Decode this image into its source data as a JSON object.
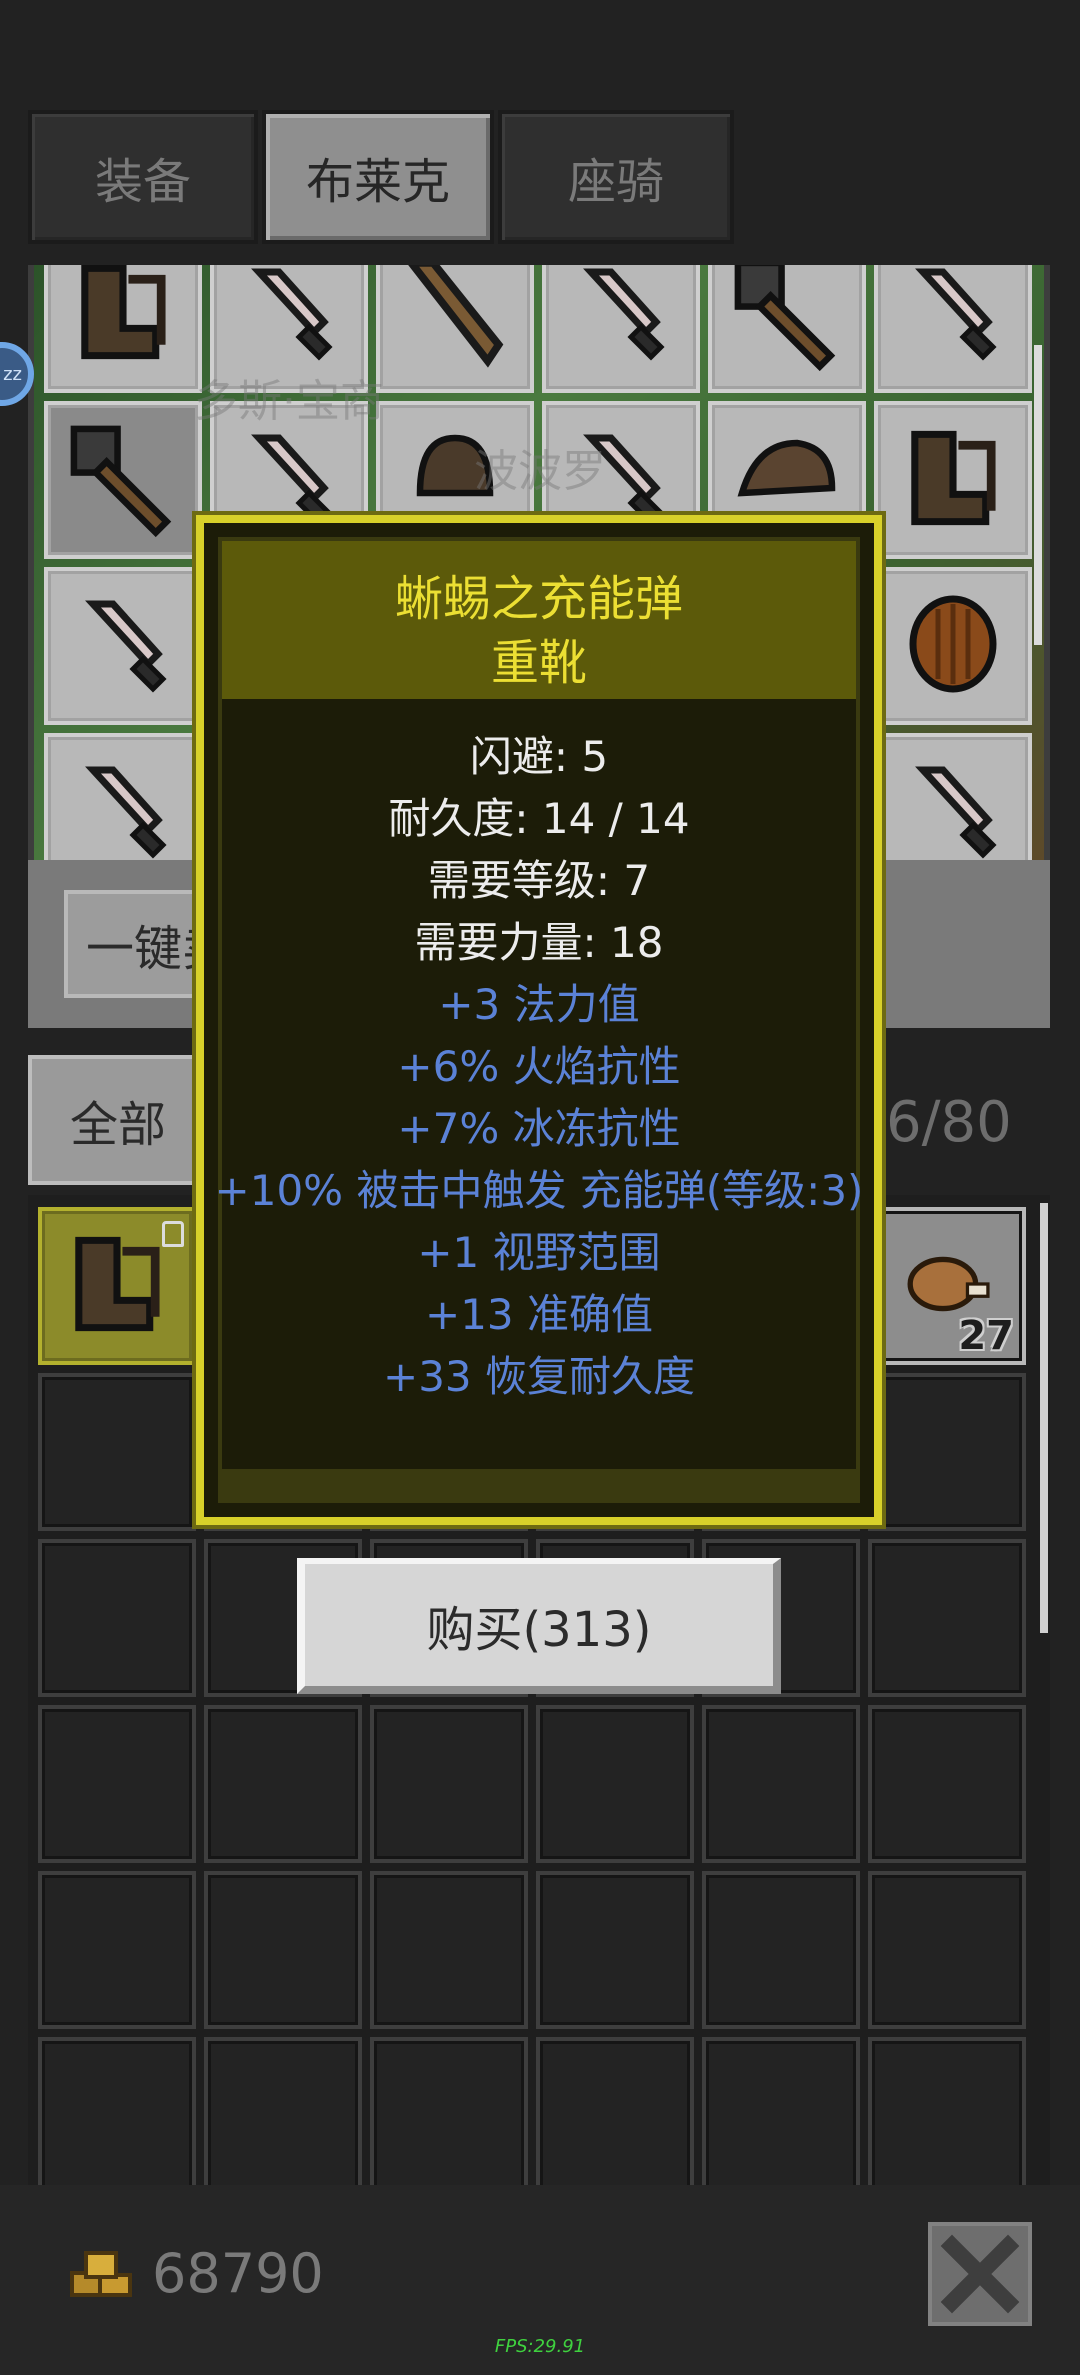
{
  "tabs": [
    {
      "label": "装备"
    },
    {
      "label": "布莱克"
    },
    {
      "label": "座骑"
    }
  ],
  "active_tab_index": 1,
  "shop": {
    "watermark_1": "多斯·宝商",
    "watermark_2": "波波罗",
    "items": [
      {
        "icon": "boots-icon"
      },
      {
        "icon": "dagger-icon"
      },
      {
        "icon": "club-icon"
      },
      {
        "icon": "dagger-icon"
      },
      {
        "icon": "mace-icon"
      },
      {
        "icon": "dagger-icon"
      },
      {
        "icon": "mace-icon"
      },
      {
        "icon": "dagger-icon"
      },
      {
        "icon": "helmet-icon"
      },
      {
        "icon": "dagger-icon"
      },
      {
        "icon": "cap-icon"
      },
      {
        "icon": "boots-icon"
      },
      {
        "icon": "dagger-icon"
      },
      {
        "icon": "empty"
      },
      {
        "icon": "empty"
      },
      {
        "icon": "empty"
      },
      {
        "icon": "empty"
      },
      {
        "icon": "shield-icon"
      },
      {
        "icon": "dagger-icon"
      },
      {
        "icon": "empty"
      },
      {
        "icon": "empty"
      },
      {
        "icon": "empty"
      },
      {
        "icon": "empty"
      },
      {
        "icon": "dagger-icon"
      }
    ]
  },
  "sell_all_label": "一键卖",
  "side_bubble": "zz",
  "inventory": {
    "filter_label": "全部",
    "count": "6/80",
    "equipped_slot_icon": "boots-icon",
    "stack_item_icon": "meat-icon",
    "stack_count": "27"
  },
  "gold": {
    "amount": "68790"
  },
  "fps": "FPS:29.91",
  "tooltip": {
    "name": "蜥蜴之充能弹",
    "type": "重靴",
    "base_stats": [
      "闪避: 5",
      "耐久度: 14 / 14",
      "需要等级: 7",
      "需要力量: 18"
    ],
    "affixes": [
      "+3 法力值",
      "+6% 火焰抗性",
      "+7% 冰冻抗性",
      "+10% 被击中触发 充能弹(等级:3)",
      "+1 视野范围",
      "+13 准确值",
      "+33 恢复耐久度"
    ]
  },
  "buy_button_label": "购买(313)",
  "colors": {
    "title": "#ecdf33",
    "affix": "#5b82d6",
    "tooltip_border": "#d8d12a"
  }
}
